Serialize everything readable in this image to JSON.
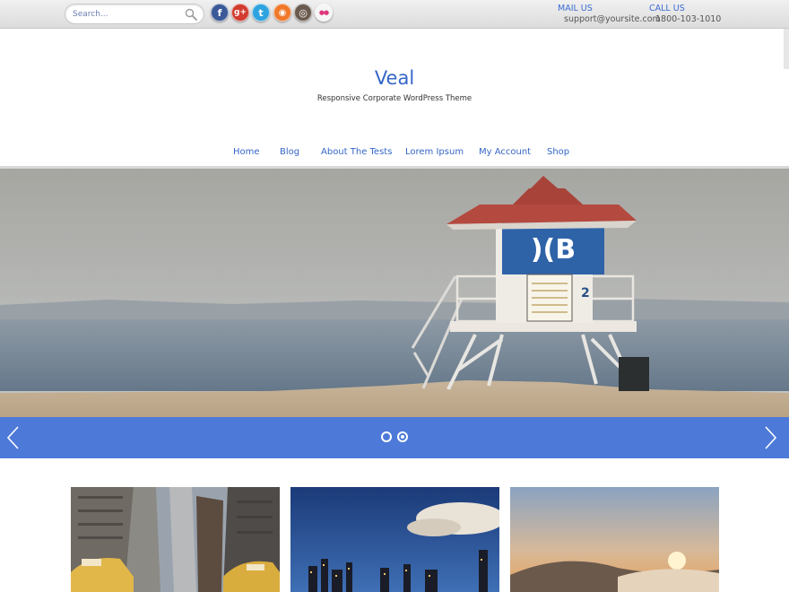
{
  "topbar": {
    "search": {
      "placeholder": "Search..."
    },
    "social": [
      {
        "name": "facebook-icon",
        "glyph": "f",
        "color": "#3b5998"
      },
      {
        "name": "google-plus-icon",
        "glyph": "g+",
        "color": "#d23b2f"
      },
      {
        "name": "twitter-icon",
        "glyph": "t",
        "color": "#2ea3e0"
      },
      {
        "name": "rss-icon",
        "glyph": "◉",
        "color": "#f0782a"
      },
      {
        "name": "instagram-icon",
        "glyph": "◎",
        "color": "#6b5a4e"
      },
      {
        "name": "flickr-icon",
        "glyph": "●●",
        "color": "#f5f5f5"
      }
    ],
    "mail": {
      "label": "MAIL US",
      "value": "support@yoursite.com"
    },
    "call": {
      "label": "CALL US",
      "value": "1800-103-1010"
    }
  },
  "header": {
    "title": "Veal",
    "tagline": "Responsive Corporate WordPress Theme"
  },
  "nav": {
    "items": [
      {
        "label": "Home"
      },
      {
        "label": "Blog"
      },
      {
        "label": "About The Tests"
      },
      {
        "label": "Lorem Ipsum"
      },
      {
        "label": "My Account"
      },
      {
        "label": "Shop"
      }
    ]
  },
  "slider": {
    "slide_count": 2,
    "active_slide": 1,
    "accent_color": "#4d7ad9",
    "tower_number": "2"
  },
  "thumbnails": [
    {
      "name": "city-street-taxis-thumbnail"
    },
    {
      "name": "night-skyline-thumbnail"
    },
    {
      "name": "sunrise-clouds-thumbnail"
    }
  ]
}
